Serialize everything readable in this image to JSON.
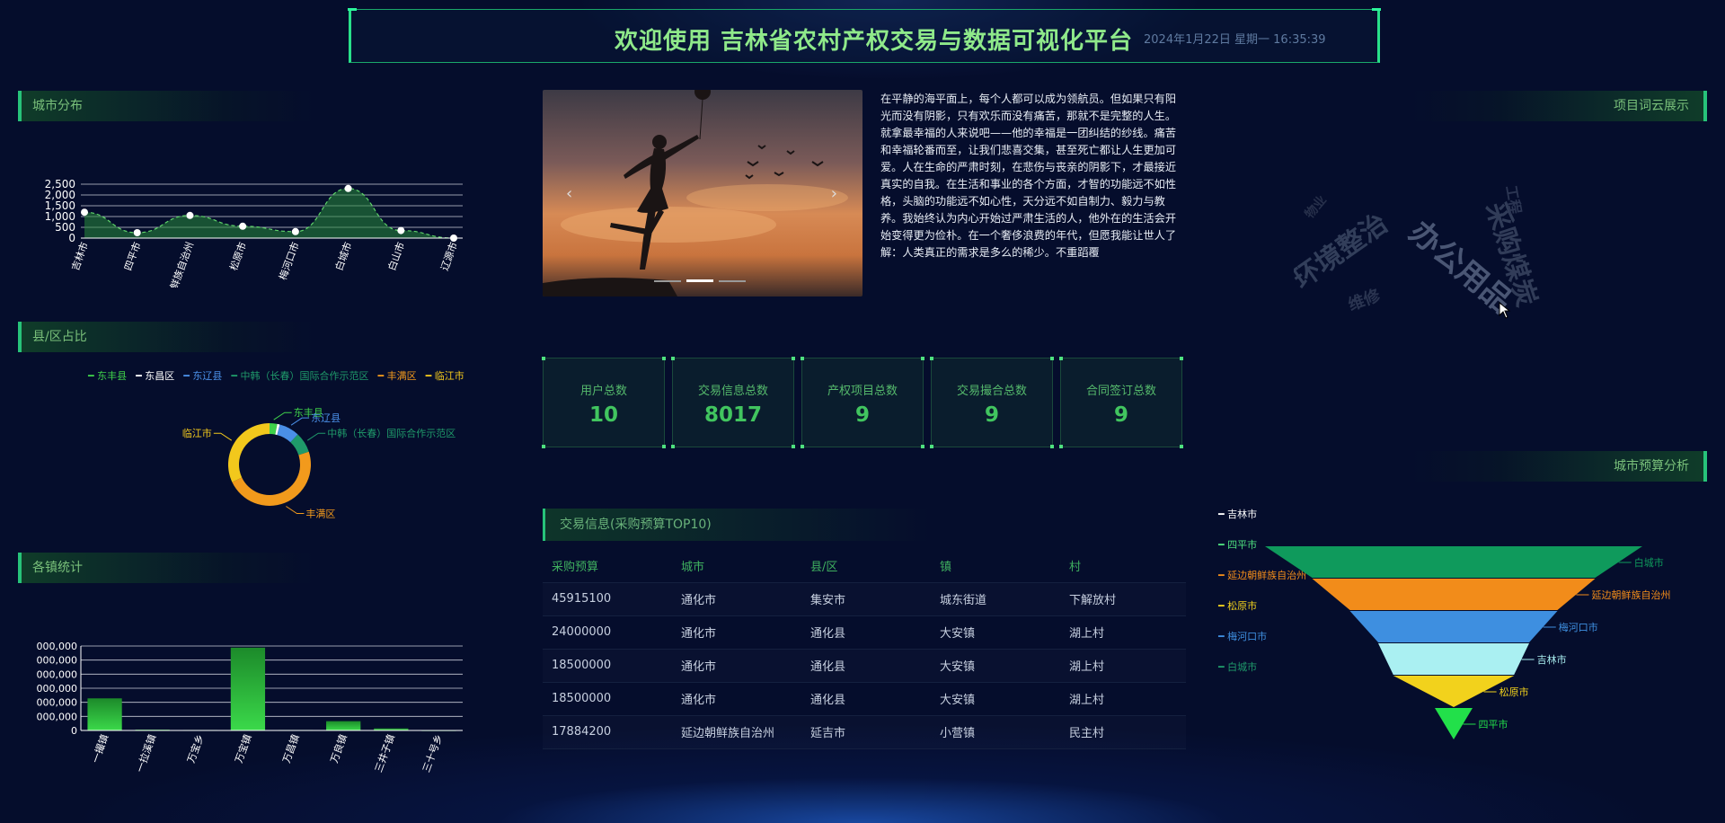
{
  "header": {
    "title": "欢迎使用 吉林省农村产权交易与数据可视化平台",
    "datetime": "2024年1月22日 星期一 16:35:39"
  },
  "panels": {
    "city_distribution": "城市分布",
    "county_share": "县/区占比",
    "town_stats": "各镇统计",
    "word_cloud": "项目词云展示",
    "city_budget": "城市预算分析",
    "transactions": "交易信息(采购预算TOP10)"
  },
  "carousel": {
    "prev": "‹",
    "next": "›",
    "active_slide": 1,
    "slide_count": 3
  },
  "article": "在平静的海平面上，每个人都可以成为领航员。但如果只有阳光而没有阴影，只有欢乐而没有痛苦，那就不是完整的人生。就拿最幸福的人来说吧——他的幸福是一团纠结的纱线。痛苦和幸福轮番而至，让我们悲喜交集，甚至死亡都让人生更加可爱。人在生命的严肃时刻，在悲伤与丧亲的阴影下，才最接近真实的自我。在生活和事业的各个方面，才智的功能远不如性格，头脑的功能远不如心性，天分远不如自制力、毅力与教养。我始终认为内心开始过严肃生活的人，他外在的生活会开始变得更为俭朴。在一个奢侈浪费的年代，但愿我能让世人了解：人类真正的需求是多么的稀少。不重蹈覆",
  "stats": [
    {
      "label": "用户总数",
      "value": "10"
    },
    {
      "label": "交易信息总数",
      "value": "8017"
    },
    {
      "label": "产权项目总数",
      "value": "9"
    },
    {
      "label": "交易撮合总数",
      "value": "9"
    },
    {
      "label": "合同签订总数",
      "value": "9"
    }
  ],
  "table": {
    "headers": [
      "采购预算",
      "城市",
      "县/区",
      "镇",
      "村"
    ],
    "rows": [
      [
        "45915100",
        "通化市",
        "集安市",
        "城东街道",
        "下解放村"
      ],
      [
        "24000000",
        "通化市",
        "通化县",
        "大安镇",
        "湖上村"
      ],
      [
        "18500000",
        "通化市",
        "通化县",
        "大安镇",
        "湖上村"
      ],
      [
        "18500000",
        "通化市",
        "通化县",
        "大安镇",
        "湖上村"
      ],
      [
        "17884200",
        "延边朝鲜族自治州",
        "延吉市",
        "小营镇",
        "民主村"
      ]
    ]
  },
  "word_cloud": {
    "words": [
      "办公用品",
      "采购煤炭",
      "环境整治",
      "维修",
      "工程",
      "物业"
    ]
  },
  "colors": {
    "accent": "#27c37a",
    "title": "#8fe98a",
    "bg": "#050d2c"
  },
  "chart_data": [
    {
      "type": "area",
      "categories": [
        "吉林市",
        "四平市",
        "延边朝鲜族自治州",
        "松原市",
        "梅河口市",
        "白城市",
        "白山市",
        "辽源市"
      ],
      "values": [
        1200,
        250,
        1050,
        550,
        300,
        2300,
        350,
        0
      ],
      "ylim": [
        0,
        2500
      ],
      "yticks": [
        "0",
        "500",
        "1,000",
        "1,500",
        "2,000",
        "2,500"
      ],
      "grid": true
    },
    {
      "type": "pie",
      "donut": true,
      "legend": "top",
      "series": [
        {
          "name": "东丰县",
          "value": 3,
          "color": "#3fd14a"
        },
        {
          "name": "东昌区",
          "value": 1,
          "color": "#ffffff"
        },
        {
          "name": "东辽县",
          "value": 8,
          "color": "#4a8fe7"
        },
        {
          "name": "中韩（长春）国际合作示范区",
          "value": 8,
          "color": "#1f9a6a"
        },
        {
          "name": "丰满区",
          "value": 48,
          "color": "#f29a1c"
        },
        {
          "name": "临江市",
          "value": 32,
          "color": "#f2c81c"
        }
      ]
    },
    {
      "type": "bar",
      "categories": [
        "一撮镇",
        "一拉溪镇",
        "万宝乡",
        "万宝镇",
        "万昌镇",
        "万良镇",
        "三井子镇",
        "三十号乡"
      ],
      "values": [
        1900000,
        50000,
        30000,
        4900000,
        30000,
        550000,
        120000,
        20000
      ],
      "ylim": [
        0,
        5000000
      ],
      "ytick_labels": [
        "0",
        "000,000",
        "000,000",
        "000,000",
        "000,000",
        "000,000",
        "000,000"
      ]
    },
    {
      "type": "funnel",
      "series": [
        {
          "name": "白城市",
          "value": 100,
          "color": "#0f9a5c"
        },
        {
          "name": "延边朝鲜族自治州",
          "value": 75,
          "color": "#f28c1a"
        },
        {
          "name": "梅河口市",
          "value": 55,
          "color": "#3e8fe0"
        },
        {
          "name": "吉林市",
          "value": 40,
          "color": "#aaf0f2"
        },
        {
          "name": "松原市",
          "value": 32,
          "color": "#f2d21c"
        },
        {
          "name": "四平市",
          "value": 0,
          "color": "#22e04a"
        }
      ],
      "legend": [
        {
          "name": "吉林市",
          "color": "#ffffff"
        },
        {
          "name": "四平市",
          "color": "#4ee07f"
        },
        {
          "name": "延边朝鲜族自治州",
          "color": "#f28c1a"
        },
        {
          "name": "松原市",
          "color": "#f2d21c"
        },
        {
          "name": "梅河口市",
          "color": "#3e8fe0"
        },
        {
          "name": "白城市",
          "color": "#1f9a6a"
        }
      ]
    }
  ]
}
